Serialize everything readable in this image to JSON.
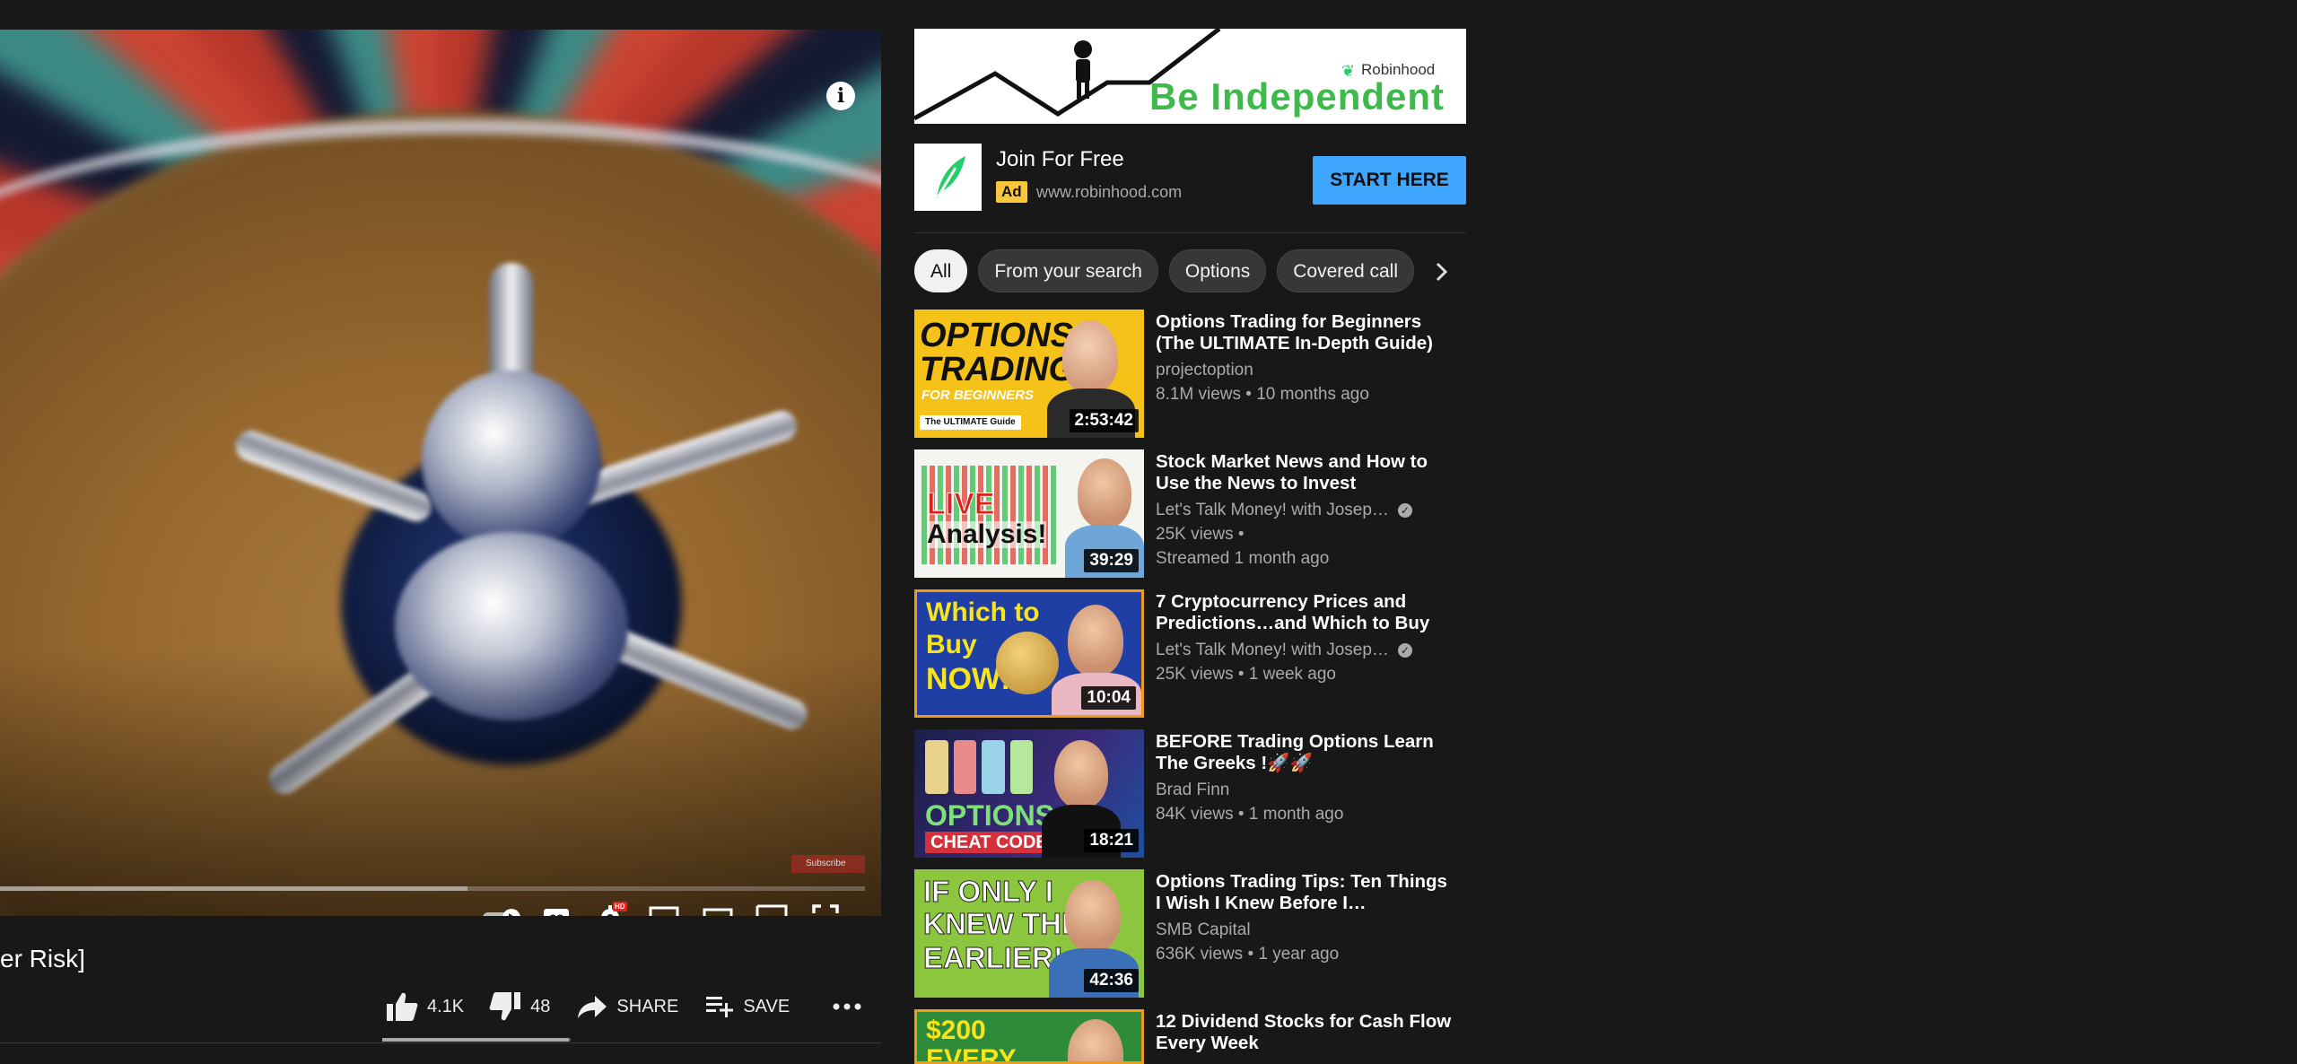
{
  "player": {
    "info_icon": "info-icon",
    "subscribe_watermark": "Subscribe",
    "progress_buffered_fraction": 0.54,
    "controls": [
      "autoplay-toggle-icon",
      "captions-icon",
      "settings-icon",
      "miniplayer-icon",
      "theater-mode-icon",
      "airplay-icon",
      "fullscreen-icon"
    ],
    "settings_badge": "HD"
  },
  "video": {
    "title_fragment": "er Risk]",
    "like_count": "4.1K",
    "dislike_count": "48",
    "share_label": "SHARE",
    "save_label": "SAVE",
    "like_ratio": 0.99
  },
  "ad": {
    "banner_brand": "Robinhood",
    "banner_slogan": "Be Independent",
    "title": "Join For Free",
    "tag": "Ad",
    "url": "www.robinhood.com",
    "cta": "START HERE"
  },
  "chips": [
    "All",
    "From your search",
    "Options",
    "Covered call"
  ],
  "recommendations": [
    {
      "title": "Options Trading for Beginners (The ULTIMATE In-Depth Guide)",
      "channel": "projectoption",
      "meta": "8.1M views • 10 months ago",
      "duration": "2:53:42",
      "verified": false,
      "thumb_text": [
        "OPTIONS",
        "TRADING",
        "FOR BEGINNERS",
        "The ULTIMATE Guide"
      ]
    },
    {
      "title": "Stock Market News and How to Use the News to Invest",
      "channel": "Let's Talk Money! with Josep…",
      "meta": "25K views •",
      "meta2": "Streamed 1 month ago",
      "duration": "39:29",
      "verified": true,
      "thumb_text": [
        "LIVE",
        "Analysis!"
      ]
    },
    {
      "title": "7 Cryptocurrency Prices and Predictions…and Which to Buy",
      "channel": "Let's Talk Money! with Josep…",
      "meta": "25K views • 1 week ago",
      "duration": "10:04",
      "verified": true,
      "thumb_text": [
        "Which to",
        "Buy",
        "NOW!"
      ]
    },
    {
      "title": "BEFORE Trading Options Learn The Greeks !🚀🚀",
      "channel": "Brad Finn",
      "meta": "84K views • 1 month ago",
      "duration": "18:21",
      "verified": false,
      "thumb_text": [
        "OPTIONS",
        "CHEAT CODE"
      ]
    },
    {
      "title": "Options Trading Tips: Ten Things I Wish I Knew Before I…",
      "channel": "SMB Capital",
      "meta": "636K views • 1 year ago",
      "duration": "42:36",
      "verified": false,
      "thumb_text": [
        "IF ONLY I",
        "KNEW THIS",
        "EARLIER!"
      ]
    },
    {
      "title": "12 Dividend Stocks for Cash Flow Every Week",
      "thumb_text": [
        "$200",
        "EVERY"
      ]
    }
  ],
  "colors": {
    "background": "#181818",
    "accent_blue": "#3ea6ff",
    "ad_tag_yellow": "#f9c73d",
    "robinhood_green": "#21ce6a"
  }
}
